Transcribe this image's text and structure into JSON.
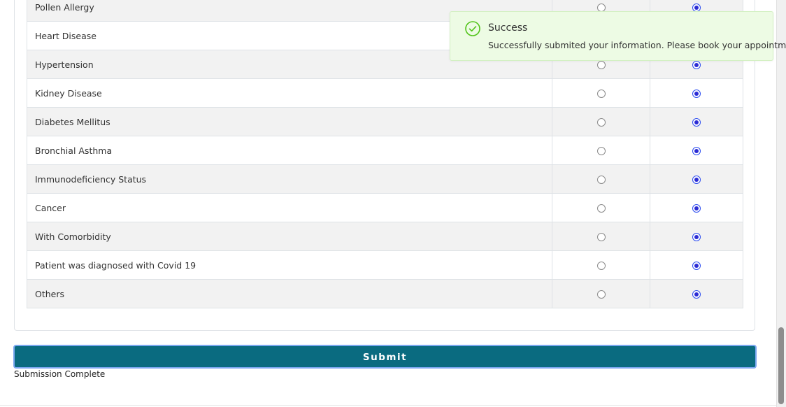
{
  "conditions": {
    "rows": [
      {
        "label": "Pollen Allergy",
        "yes": false,
        "no": true
      },
      {
        "label": "Heart Disease",
        "yes": false,
        "no": true
      },
      {
        "label": "Hypertension",
        "yes": false,
        "no": true
      },
      {
        "label": "Kidney Disease",
        "yes": false,
        "no": true
      },
      {
        "label": "Diabetes Mellitus",
        "yes": false,
        "no": true
      },
      {
        "label": "Bronchial Asthma",
        "yes": false,
        "no": true
      },
      {
        "label": "Immunodeficiency Status",
        "yes": false,
        "no": true
      },
      {
        "label": "Cancer",
        "yes": false,
        "no": true
      },
      {
        "label": "With Comorbidity",
        "yes": false,
        "no": true
      },
      {
        "label": "Patient was diagnosed with Covid 19",
        "yes": false,
        "no": true
      },
      {
        "label": "Others",
        "yes": false,
        "no": true
      }
    ]
  },
  "form": {
    "submit_label": "Submit",
    "status_text": "Submission Complete"
  },
  "toast": {
    "title": "Success",
    "message": "Successfully submited your information. Please book your appointment",
    "icon": "check-circle-icon",
    "accent": "#52c41a"
  },
  "colors": {
    "submit_bg": "#0a6b80",
    "radio_checked": "#2b2bd4",
    "toast_bg": "#edfbe4"
  }
}
